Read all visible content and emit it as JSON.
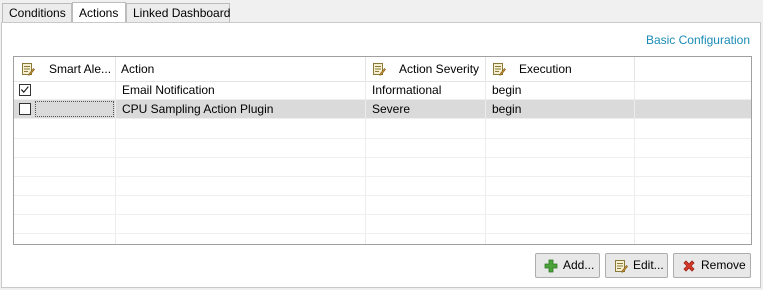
{
  "tabs": [
    {
      "label": "Conditions",
      "active": false
    },
    {
      "label": "Actions",
      "active": true
    },
    {
      "label": "Linked Dashboard",
      "active": false
    }
  ],
  "basic_configuration_link": "Basic Configuration",
  "table": {
    "columns": [
      {
        "label": "Smart Ale...",
        "icon": "note-edit-icon"
      },
      {
        "label": "Action",
        "icon": null
      },
      {
        "label": "Action Severity",
        "icon": "note-edit-icon"
      },
      {
        "label": "Execution",
        "icon": "note-edit-icon"
      }
    ],
    "rows": [
      {
        "checked": true,
        "action": "Email Notification",
        "severity": "Informational",
        "execution": "begin",
        "selected": false
      },
      {
        "checked": false,
        "action": "CPU Sampling Action Plugin",
        "severity": "Severe",
        "execution": "begin",
        "selected": true
      }
    ]
  },
  "buttons": {
    "add": {
      "label": "Add...",
      "icon": "plus-icon"
    },
    "edit": {
      "label": "Edit...",
      "icon": "note-edit-icon"
    },
    "remove": {
      "label": "Remove",
      "icon": "red-x-icon"
    }
  },
  "colors": {
    "link": "#1a8bb5",
    "selected_row": "#dadada",
    "add_icon": "#4aa33a",
    "remove_icon": "#d83a2a"
  }
}
